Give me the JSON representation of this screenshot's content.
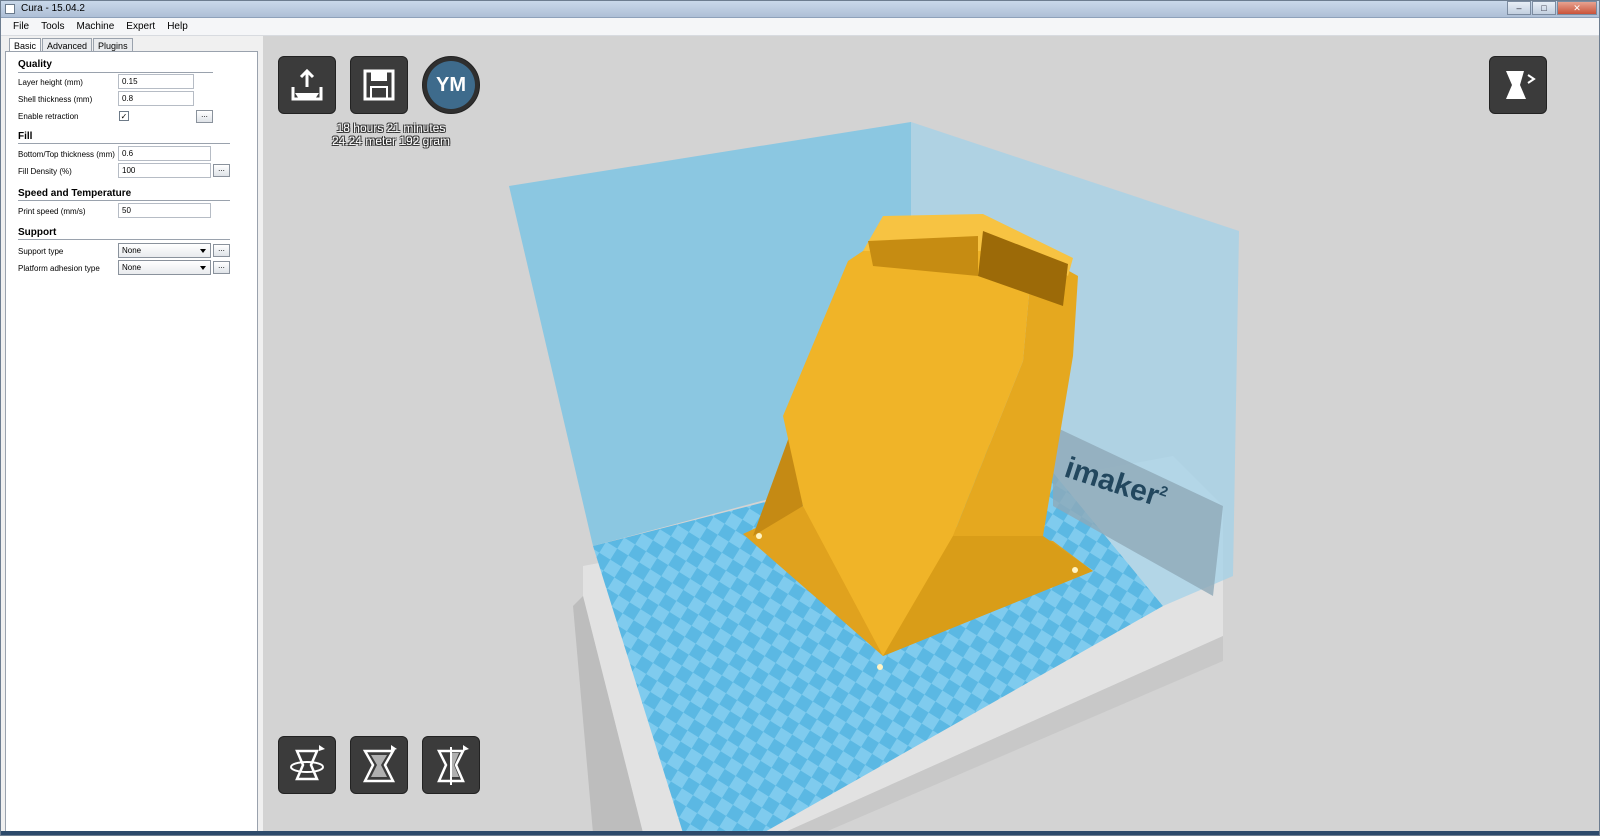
{
  "window": {
    "title": "Cura - 15.04.2"
  },
  "menu": [
    "File",
    "Tools",
    "Machine",
    "Expert",
    "Help"
  ],
  "tabs": [
    "Basic",
    "Advanced",
    "Plugins"
  ],
  "quality": {
    "title": "Quality",
    "layer_height_label": "Layer height (mm)",
    "layer_height_value": "0.15",
    "shell_thickness_label": "Shell thickness (mm)",
    "shell_thickness_value": "0.8",
    "enable_retraction_label": "Enable retraction",
    "enable_retraction_checked": true
  },
  "fill": {
    "title": "Fill",
    "bottom_top_label": "Bottom/Top thickness (mm)",
    "bottom_top_value": "0.6",
    "density_label": "Fill Density (%)",
    "density_value": "100"
  },
  "speed": {
    "title": "Speed and Temperature",
    "print_speed_label": "Print speed (mm/s)",
    "print_speed_value": "50"
  },
  "support": {
    "title": "Support",
    "support_type_label": "Support type",
    "support_type_value": "None",
    "adhesion_label": "Platform adhesion type",
    "adhesion_value": "None"
  },
  "dots_label": "...",
  "viewport": {
    "print_time": "18 hours 21 minutes",
    "print_material": "24.24 meter 192 gram",
    "ym_label": "YM",
    "brand_text": "imaker",
    "brand_sup": "2"
  },
  "colors": {
    "model": "#f0b428",
    "build_volume": "#7ec4e3",
    "viewport_bg": "#d3d3d3"
  },
  "icons": {
    "load": "load-model-icon",
    "save": "save-icon",
    "ym": "youmagine-icon",
    "view_mode": "view-mode-icon",
    "rotate": "rotate-icon",
    "scale": "scale-icon",
    "mirror": "mirror-icon"
  }
}
